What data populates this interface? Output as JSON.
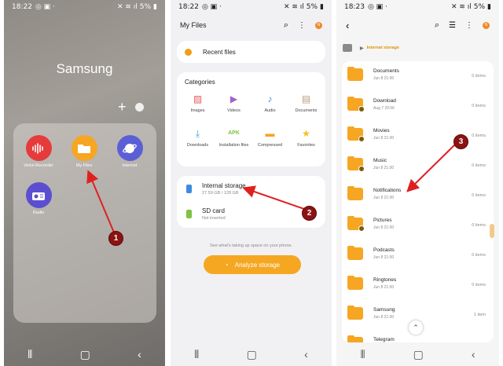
{
  "phone1": {
    "status": {
      "time": "18:22",
      "right_text": "5%"
    },
    "brand": "Samsung",
    "apps": [
      {
        "label": "Voice Recorder",
        "icon": "waveform-icon",
        "color": "#e63b3b"
      },
      {
        "label": "My Files",
        "icon": "folder-icon",
        "color": "#f6a622"
      },
      {
        "label": "Internet",
        "icon": "planet-icon",
        "color": "#5b5fd6"
      },
      {
        "label": "Radio",
        "icon": "radio-icon",
        "color": "#5b4fd0"
      }
    ]
  },
  "phone2": {
    "status": {
      "time": "18:22",
      "right_text": "5%"
    },
    "title": "My Files",
    "avatar": "N",
    "recent": "Recent files",
    "categories_title": "Categories",
    "categories": [
      {
        "label": "Images",
        "glyph": "▨",
        "color": "#e85d5d"
      },
      {
        "label": "Videos",
        "glyph": "▶",
        "color": "#a061d1"
      },
      {
        "label": "Audio",
        "glyph": "♪",
        "color": "#3d8be0"
      },
      {
        "label": "Documents",
        "glyph": "▤",
        "color": "#b89a80"
      },
      {
        "label": "Downloads",
        "glyph": "⤓",
        "color": "#3fa9d8"
      },
      {
        "label": "Installation files",
        "glyph": "APK",
        "color": "#7fc241"
      },
      {
        "label": "Compressed",
        "glyph": "▬",
        "color": "#f6a622"
      },
      {
        "label": "Favorites",
        "glyph": "★",
        "color": "#f3c21b"
      }
    ],
    "storage": [
      {
        "name": "Internal storage",
        "sub": "27.59 GB / 128 GB",
        "color": "#3d8be0"
      },
      {
        "name": "SD card",
        "sub": "Not inserted",
        "color": "#7fc241"
      }
    ],
    "hint": "See what's taking up space on your phone.",
    "analyze": "Analyze storage"
  },
  "phone3": {
    "status": {
      "time": "18:23",
      "right_text": "5%"
    },
    "avatar": "N",
    "crumb": "Internal storage",
    "folders": [
      {
        "name": "Documents",
        "date": "Jun 8 21:00",
        "count": "0 items",
        "sub": false
      },
      {
        "name": "Download",
        "date": "Aug 7 20:56",
        "count": "0 items",
        "sub": true
      },
      {
        "name": "Movies",
        "date": "Jun 8 21:00",
        "count": "0 items",
        "sub": true
      },
      {
        "name": "Music",
        "date": "Jun 8 21:00",
        "count": "0 items",
        "sub": true
      },
      {
        "name": "Notifications",
        "date": "Jun 8 21:00",
        "count": "0 items",
        "sub": false
      },
      {
        "name": "Pictures",
        "date": "Jun 8 21:00",
        "count": "0 items",
        "sub": true
      },
      {
        "name": "Podcasts",
        "date": "Jun 8 21:00",
        "count": "0 items",
        "sub": false
      },
      {
        "name": "Ringtones",
        "date": "Jun 8 21:00",
        "count": "0 items",
        "sub": false
      },
      {
        "name": "Samsung",
        "date": "Jun 8 21:00",
        "count": "1 item",
        "sub": false
      },
      {
        "name": "Telegram",
        "date": "",
        "count": "",
        "sub": false
      }
    ]
  },
  "annotations": [
    "1",
    "2",
    "3"
  ],
  "colors": {
    "accent": "#f6a622",
    "arrow": "#e02020",
    "badge": "#8b1313"
  }
}
